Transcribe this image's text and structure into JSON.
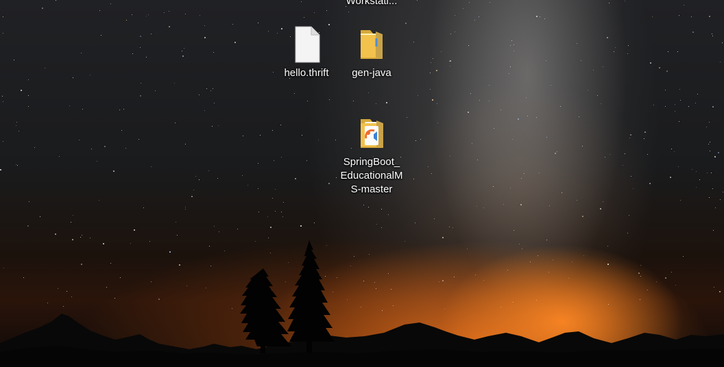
{
  "desktop": {
    "partial_item": {
      "label": "Workstati..."
    },
    "icons": [
      {
        "label": "hello.thrift",
        "icon": "blank-file-icon"
      },
      {
        "label": "gen-java",
        "icon": "folder-icon"
      },
      {
        "label": "SpringBoot_ EducationalMS-master",
        "icon": "project-folder-icon"
      }
    ]
  },
  "colors": {
    "label_text": "#ffffff",
    "folder_yellow": "#f2c24d",
    "sky_orange": "#f08a24"
  }
}
